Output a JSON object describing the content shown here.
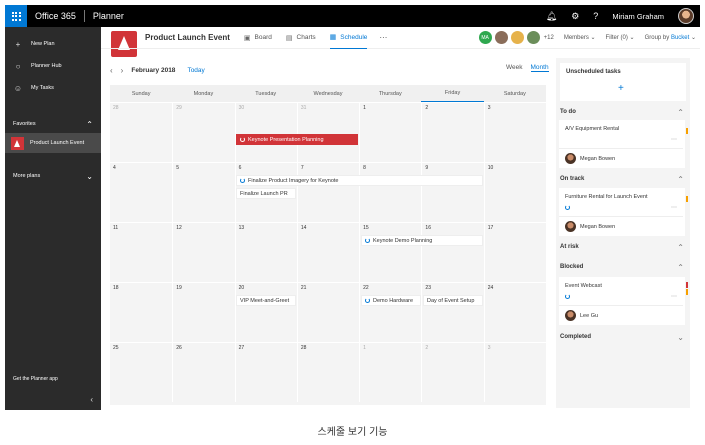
{
  "topbar": {
    "suite": "Office 365",
    "app": "Planner",
    "user": "Miriam Graham",
    "icons": [
      "bell-icon",
      "gear-icon",
      "help-icon"
    ]
  },
  "sidebar": {
    "items": [
      {
        "label": "New Plan",
        "icon": "plus-icon"
      },
      {
        "label": "Planner Hub",
        "icon": "circle-icon"
      },
      {
        "label": "My Tasks",
        "icon": "person-icon"
      }
    ],
    "favorites_label": "Favorites",
    "favorite_plan": "Product Launch Event",
    "more_plans": "More plans",
    "get_app": "Get the Planner app"
  },
  "plan": {
    "title": "Product Launch Event",
    "tabs": [
      "Board",
      "Charts",
      "Schedule"
    ],
    "active_tab": "Schedule",
    "member_initials": "MA",
    "extra_members": "+12",
    "members_label": "Members",
    "filter_label": "Filter (0)",
    "group_label": "Group by",
    "group_value": "Bucket"
  },
  "calendar": {
    "month": "February 2018",
    "today": "Today",
    "views": [
      "Week",
      "Month"
    ],
    "active_view": "Month",
    "days": [
      "Sunday",
      "Monday",
      "Tuesday",
      "Wednesday",
      "Thursday",
      "Friday",
      "Saturday"
    ],
    "weeks": [
      [
        "28",
        "29",
        "30",
        "31",
        "1",
        "2",
        "3"
      ],
      [
        "4",
        "5",
        "6",
        "7",
        "8",
        "9",
        "10"
      ],
      [
        "11",
        "12",
        "13",
        "14",
        "15",
        "16",
        "17"
      ],
      [
        "18",
        "19",
        "20",
        "21",
        "22",
        "23",
        "24"
      ],
      [
        "25",
        "26",
        "27",
        "28",
        "1",
        "2",
        "3"
      ]
    ],
    "tasks": {
      "keynote_planning": "Keynote Presentation Planning",
      "product_imagery": "Finalize Product Imagery for Keynote",
      "launch_pr": "Finalize Launch PR",
      "keynote_demo": "Keynote Demo Planning",
      "vip_meet": "VIP Meet-and-Greet",
      "demo_hardware": "Demo Hardware",
      "event_setup": "Day of Event Setup"
    }
  },
  "panel": {
    "unscheduled": "Unscheduled tasks",
    "buckets": {
      "todo": "To do",
      "ontrack": "On track",
      "atrisk": "At risk",
      "blocked": "Blocked",
      "completed": "Completed"
    },
    "cards": {
      "av_rental": {
        "title": "A/V Equipment Rental",
        "assignee": "Megan Bowen"
      },
      "furniture": {
        "title": "Furniture Rental for Launch Event",
        "assignee": "Megan Bowen"
      },
      "webcast": {
        "title": "Event Webcast",
        "assignee": "Lee Gu"
      }
    }
  },
  "colors": {
    "accent": "#0078d4",
    "brand_red": "#d13438",
    "flag_orange": "#f7a000"
  },
  "caption": "스케줄 보기 기능"
}
